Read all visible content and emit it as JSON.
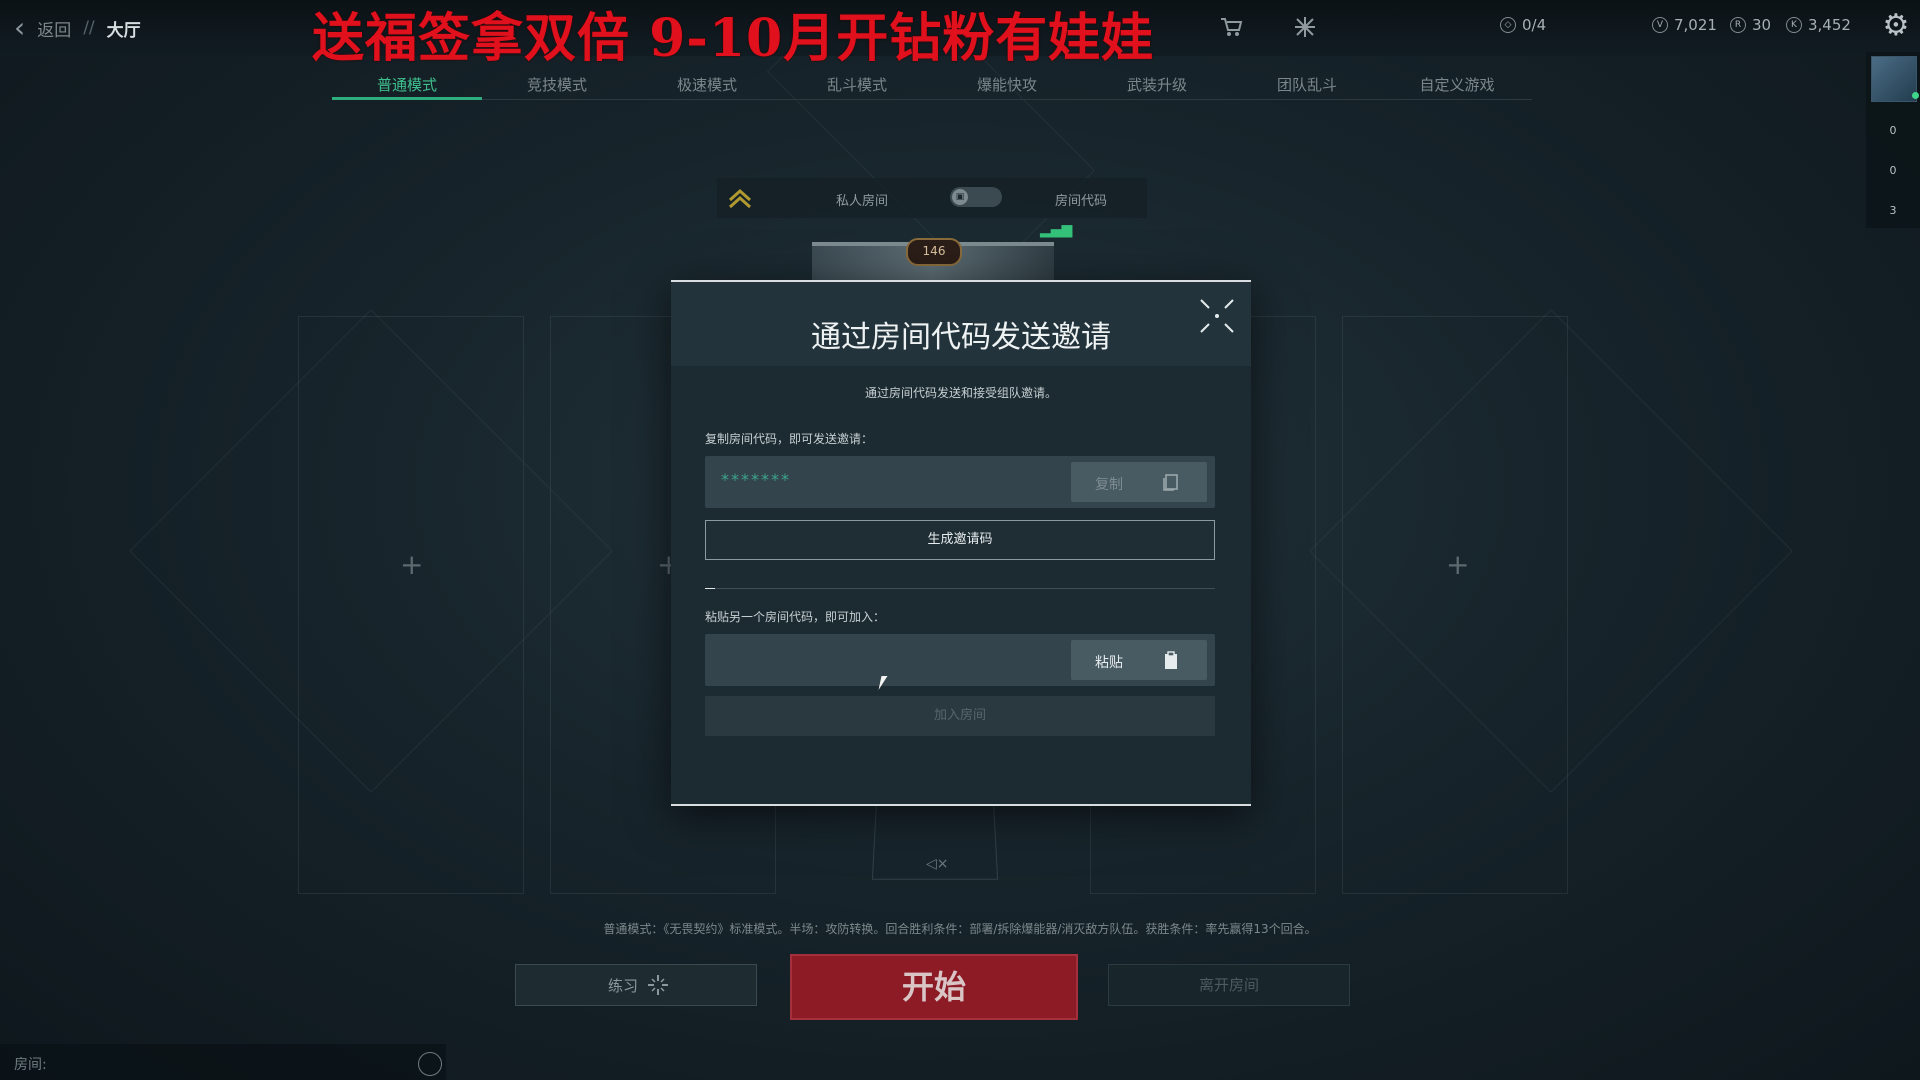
{
  "topbar": {
    "back_label": "返回",
    "separator": "//",
    "current": "大厅",
    "banner": "送福签拿双倍 9-10月开钻粉有娃娃",
    "currencies": {
      "missions": "0/4",
      "vp": "7,021",
      "radianite": "30",
      "kingdom": "3,452"
    }
  },
  "rail": {
    "counts": [
      "0",
      "0",
      "3"
    ]
  },
  "tabs": [
    "普通模式",
    "竞技模式",
    "极速模式",
    "乱斗模式",
    "爆能快攻",
    "武装升级",
    "团队乱斗",
    "自定义游戏"
  ],
  "room": {
    "private_label": "私人房间",
    "code_label": "房间代码",
    "level": "146"
  },
  "modal": {
    "title": "通过房间代码发送邀请",
    "description": "通过房间代码发送和接受组队邀请。",
    "copy_section_label": "复制房间代码，即可发送邀请：",
    "code_value": "*******",
    "copy_button": "复制",
    "generate_button": "生成邀请码",
    "paste_section_label": "粘贴另一个房间代码，即可加入：",
    "paste_input_value": "",
    "paste_button": "粘贴",
    "join_button": "加入房间"
  },
  "footer": {
    "mode_description": "普通模式：《无畏契约》标准模式。半场：攻防转换。回合胜利条件：部署/拆除爆能器/消灭敌方队伍。获胜条件：率先赢得13个回合。",
    "practice_button": "练习",
    "start_button": "开始",
    "leave_button": "离开房间",
    "chat_label": "房间:"
  },
  "colors": {
    "accent_green": "#2fae7d",
    "banner_red": "#e0101c",
    "start_red": "#8c1b26"
  }
}
